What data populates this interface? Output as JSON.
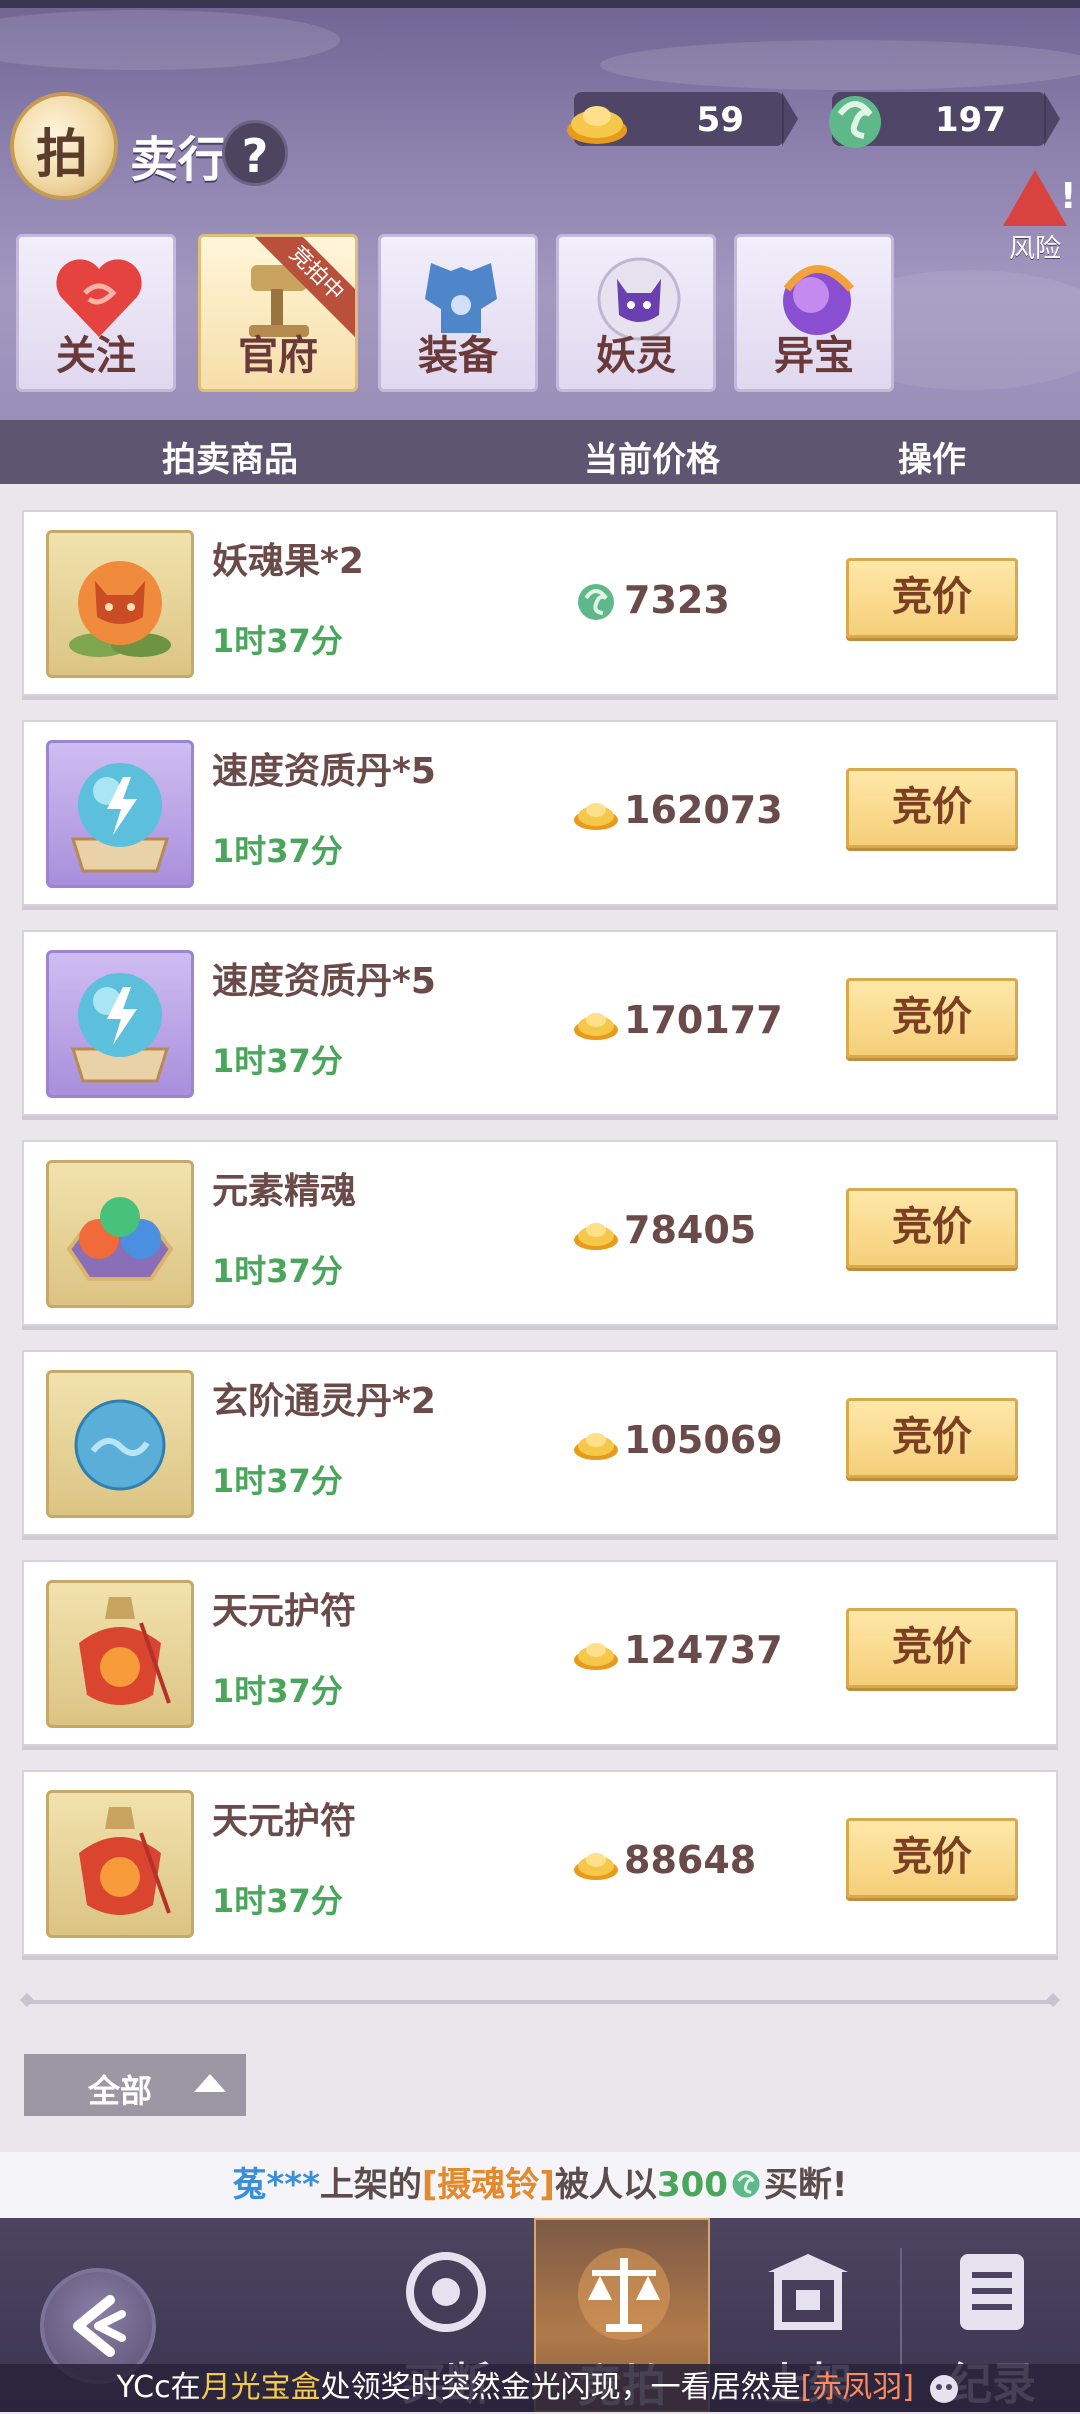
{
  "header": {
    "title_first_char": "拍",
    "title_rest": "卖行",
    "help_label": "?",
    "risk_label": "风险",
    "currencies": [
      {
        "icon": "gold-ingot-icon",
        "value": "59"
      },
      {
        "icon": "jade-coin-icon",
        "value": "197"
      }
    ]
  },
  "tabs": [
    {
      "label": "关注",
      "icon": "heart-icon",
      "active": false
    },
    {
      "label": "官府",
      "icon": "gavel-icon",
      "active": true,
      "ribbon": "竞拍中"
    },
    {
      "label": "装备",
      "icon": "armor-icon",
      "active": false
    },
    {
      "label": "妖灵",
      "icon": "demon-spirit-icon",
      "active": false
    },
    {
      "label": "异宝",
      "icon": "treasure-orb-icon",
      "active": false
    }
  ],
  "columns": {
    "item": "拍卖商品",
    "price": "当前价格",
    "action": "操作"
  },
  "items": [
    {
      "name": "妖魂果*2",
      "time": "1时37分",
      "currency": "jade-coin-icon",
      "price": "7323",
      "bid_label": "竞价",
      "icon": "demon-fruit-icon"
    },
    {
      "name": "速度资质丹*5",
      "time": "1时37分",
      "currency": "gold-ingot-icon",
      "price": "162073",
      "bid_label": "竞价",
      "icon": "lightning-orb-icon"
    },
    {
      "name": "速度资质丹*5",
      "time": "1时37分",
      "currency": "gold-ingot-icon",
      "price": "170177",
      "bid_label": "竞价",
      "icon": "lightning-orb-icon"
    },
    {
      "name": "元素精魂",
      "time": "1时37分",
      "currency": "gold-ingot-icon",
      "price": "78405",
      "bid_label": "竞价",
      "icon": "element-orbs-icon"
    },
    {
      "name": "玄阶通灵丹*2",
      "time": "1时37分",
      "currency": "gold-ingot-icon",
      "price": "105069",
      "bid_label": "竞价",
      "icon": "blue-pill-icon"
    },
    {
      "name": "天元护符",
      "time": "1时37分",
      "currency": "gold-ingot-icon",
      "price": "124737",
      "bid_label": "竞价",
      "icon": "talisman-icon"
    },
    {
      "name": "天元护符",
      "time": "1时37分",
      "currency": "gold-ingot-icon",
      "price": "88648",
      "bid_label": "竞价",
      "icon": "talisman-icon"
    }
  ],
  "filter": {
    "label": "全部"
  },
  "ticker": {
    "user": "菟***",
    "text1": "上架的",
    "item": "[摄魂铃]",
    "text2": "被人以",
    "amount": "300",
    "text3": "买断!"
  },
  "nav": [
    {
      "label": "买断",
      "icon": "buyout-icon",
      "active": false
    },
    {
      "label": "竞拍",
      "icon": "scales-icon",
      "active": true
    },
    {
      "label": "上架",
      "icon": "shop-stall-icon",
      "active": false
    },
    {
      "label": "纪录",
      "icon": "record-list-icon",
      "active": false
    }
  ],
  "marquee": {
    "user": "YCc",
    "t1": "在",
    "place": "月光宝盒",
    "t2": "处领奖时突然金光闪现，一看居然是",
    "prize": "[赤凤羽]"
  },
  "colors": {
    "header_purple": "#8c80ad",
    "bid_gold": "#f5cf79",
    "time_green": "#4aa65a",
    "name_brown": "#6b4a4a"
  }
}
